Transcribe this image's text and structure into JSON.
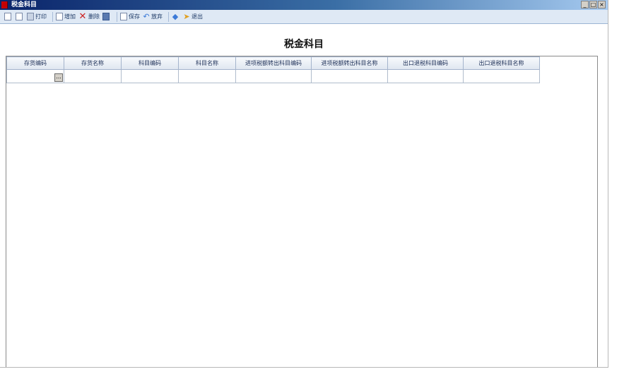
{
  "window": {
    "title": "税金科目",
    "controls": {
      "minimize": "_",
      "maximize": "□",
      "close": "×"
    }
  },
  "toolbar": {
    "items": [
      {
        "label": "",
        "icon": "document-icon"
      },
      {
        "label": "",
        "icon": "document-icon"
      },
      {
        "label": "打印",
        "icon": "print-icon"
      },
      {
        "label": "增加",
        "icon": "document-icon"
      },
      {
        "label": "删除",
        "icon": "delete-icon"
      },
      {
        "label": "",
        "icon": "save-icon"
      },
      {
        "label": "保存",
        "icon": "document-icon"
      },
      {
        "label": "放弃",
        "icon": "undo-icon"
      },
      {
        "label": "",
        "icon": "help-icon"
      },
      {
        "label": "退出",
        "icon": "exit-icon"
      }
    ]
  },
  "page": {
    "title": "税金科目"
  },
  "grid": {
    "columns": [
      "存货编码",
      "存货名称",
      "科目编码",
      "科目名称",
      "进项税额转出科目编码",
      "进项税额转出科目名称",
      "出口退税科目编码",
      "出口退税科目名称"
    ],
    "ellipsis": "..."
  },
  "colors": {
    "title_bar": "#0a246a",
    "toolbar_bg": "#dfe9f5",
    "header_bg": "#dfe6f0"
  }
}
